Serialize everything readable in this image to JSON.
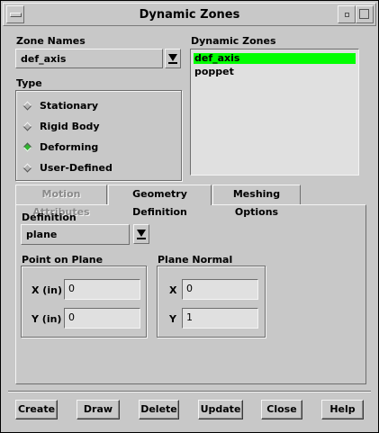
{
  "window": {
    "title": "Dynamic Zones"
  },
  "zone_names": {
    "label": "Zone Names",
    "value": "def_axis"
  },
  "dynamic_zones": {
    "label": "Dynamic Zones",
    "items": [
      "def_axis",
      "poppet"
    ],
    "selected": "def_axis"
  },
  "type": {
    "label": "Type",
    "options": [
      "Stationary",
      "Rigid Body",
      "Deforming",
      "User-Defined"
    ],
    "selected": "Deforming"
  },
  "tabs": {
    "motion": "Motion Attributes",
    "geometry": "Geometry Definition",
    "meshing": "Meshing Options",
    "active": "Geometry Definition"
  },
  "geometry": {
    "definition_label": "Definition",
    "definition_value": "plane",
    "point_label": "Point on Plane",
    "point_x_label": "X (in)",
    "point_x_value": "0",
    "point_y_label": "Y (in)",
    "point_y_value": "0",
    "normal_label": "Plane Normal",
    "normal_x_label": "X",
    "normal_x_value": "0",
    "normal_y_label": "Y",
    "normal_y_value": "1"
  },
  "buttons": {
    "create": "Create",
    "draw": "Draw",
    "delete": "Delete",
    "update": "Update",
    "close": "Close",
    "help": "Help"
  },
  "colors": {
    "selection": "#00ff00",
    "radio_on": "#2fb52f",
    "background": "#c8c8c8"
  }
}
